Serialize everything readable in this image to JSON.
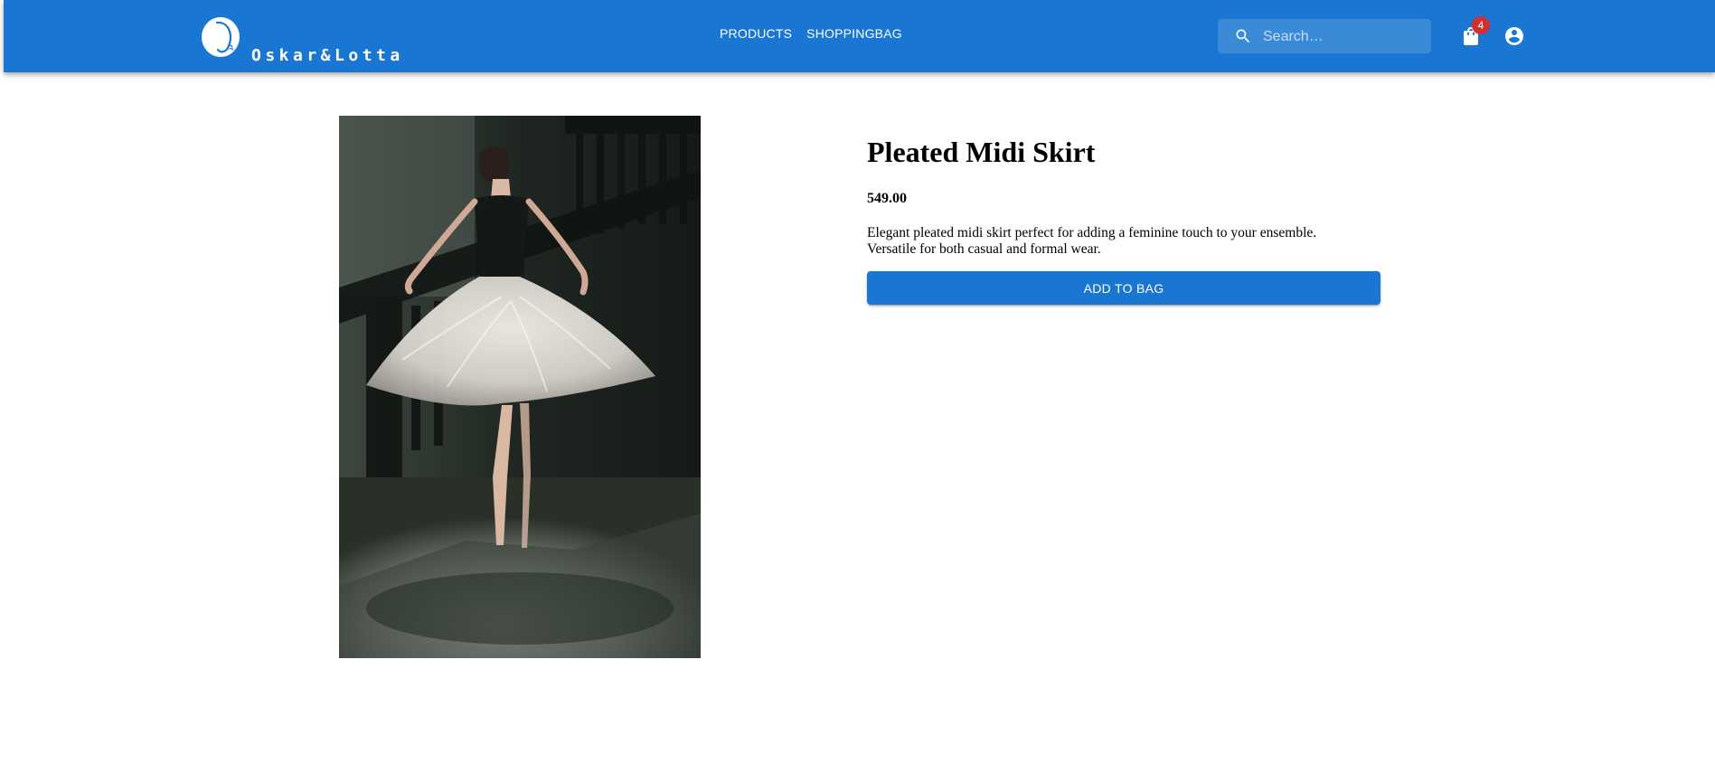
{
  "brand": {
    "name": "Oskar&Lotta",
    "logo_icon": "oskar-lotta-logo-icon"
  },
  "nav": {
    "items": [
      {
        "label": "PRODUCTS"
      },
      {
        "label": "SHOPPINGBAG"
      }
    ]
  },
  "search": {
    "placeholder": "Search…",
    "value": "",
    "icon": "search-icon"
  },
  "cart": {
    "count": "4",
    "icon": "shopping-bag-icon"
  },
  "account": {
    "icon": "account-circle-icon"
  },
  "product": {
    "title": "Pleated Midi Skirt",
    "price": "549.00",
    "description": "Elegant pleated midi skirt perfect for adding a feminine touch to your ensemble. Versatile for both casual and formal wear.",
    "image_alt": "Pleated Midi Skirt",
    "add_to_bag_label": "ADD TO BAG"
  },
  "colors": {
    "primary": "#1976d2",
    "badge": "#d32f2f",
    "background": "#ffffff"
  }
}
